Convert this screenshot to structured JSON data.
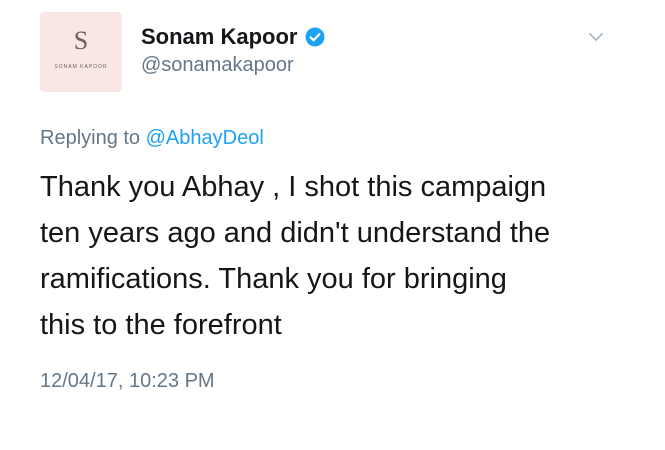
{
  "avatar": {
    "monogram": "S",
    "wordmark": "SONAM KAPOOR"
  },
  "user": {
    "display_name": "Sonam Kapoor",
    "handle": "@sonamakapoor",
    "verified_icon": "verified-badge-icon"
  },
  "reply": {
    "prefix": "Replying to",
    "mention": "@AbhayDeol"
  },
  "tweet": {
    "lines": [
      "Thank you Abhay , I shot this campaign",
      "ten years ago and didn't understand the",
      "ramifications. Thank you for bringing",
      "this to the forefront"
    ],
    "timestamp": "12/04/17, 10:23 PM"
  },
  "colors": {
    "link": "#1da1f2",
    "secondary_text": "#657786",
    "avatar_bg": "#f8e7e4"
  }
}
